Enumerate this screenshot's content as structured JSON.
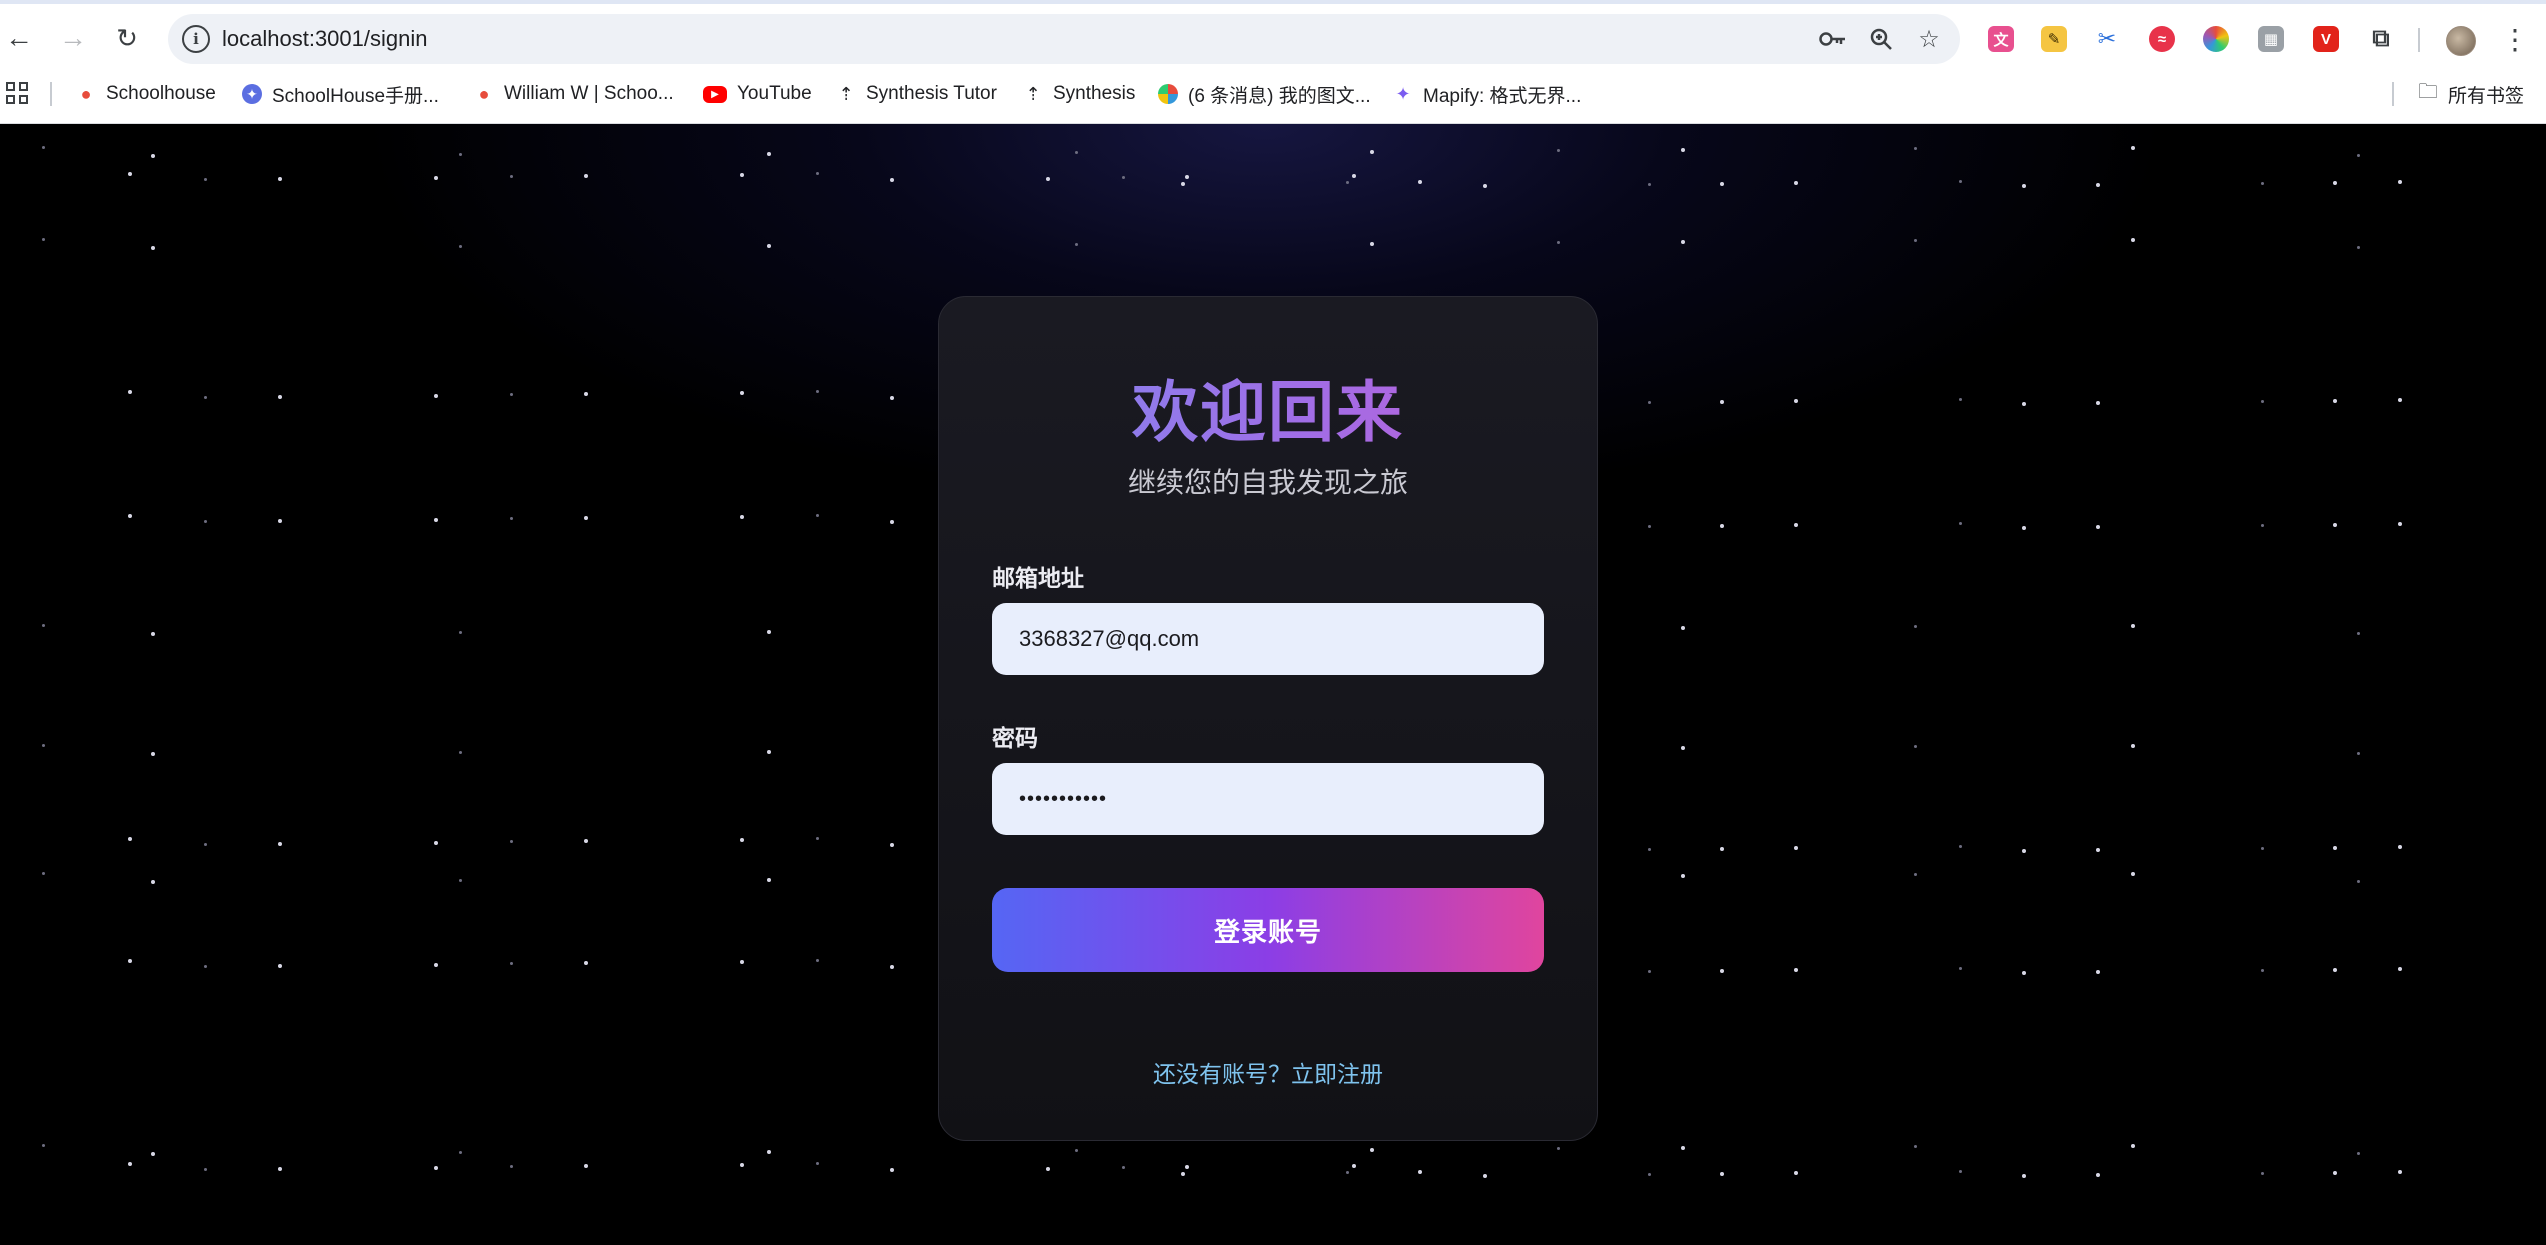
{
  "browser": {
    "url": "localhost:3001/signin",
    "bookmarks": [
      {
        "label": "Schoolhouse",
        "icon": "apple-icon",
        "color": "#e74c3c"
      },
      {
        "label": "SchoolHouse手册...",
        "icon": "compass-icon",
        "color": "#5b6ee1"
      },
      {
        "label": "William W | Schoo...",
        "icon": "apple-icon",
        "color": "#e74c3c"
      },
      {
        "label": "YouTube",
        "icon": "youtube-icon",
        "color": "#ff0000"
      },
      {
        "label": "Synthesis Tutor",
        "icon": "synthesis-icon",
        "color": "#202124"
      },
      {
        "label": "Synthesis",
        "icon": "synthesis-icon",
        "color": "#202124"
      },
      {
        "label": "(6 条消息) 我的图文...",
        "icon": "pinwheel-icon",
        "color": "#e74c3c"
      },
      {
        "label": "Mapify: 格式无界...",
        "icon": "mapify-icon",
        "color": "#7b5cf0"
      }
    ],
    "all_bookmarks_label": "所有书签"
  },
  "signin": {
    "title": "欢迎回来",
    "subtitle": "继续您的自我发现之旅",
    "email_label": "邮箱地址",
    "email_value": "3368327@qq.com",
    "password_label": "密码",
    "password_value": "•••••••••••",
    "submit_label": "登录账号",
    "signup_link": "还没有账号？立即注册"
  },
  "colors": {
    "page_background": "#000000",
    "card_background": "#16161c",
    "input_background": "#e8eefc",
    "button_gradient_start": "#5566f4",
    "button_gradient_end": "#e0459e",
    "title_gradient_start": "#7d8af0",
    "title_gradient_end": "#c55bd6",
    "link_color": "#7fc3ee"
  }
}
